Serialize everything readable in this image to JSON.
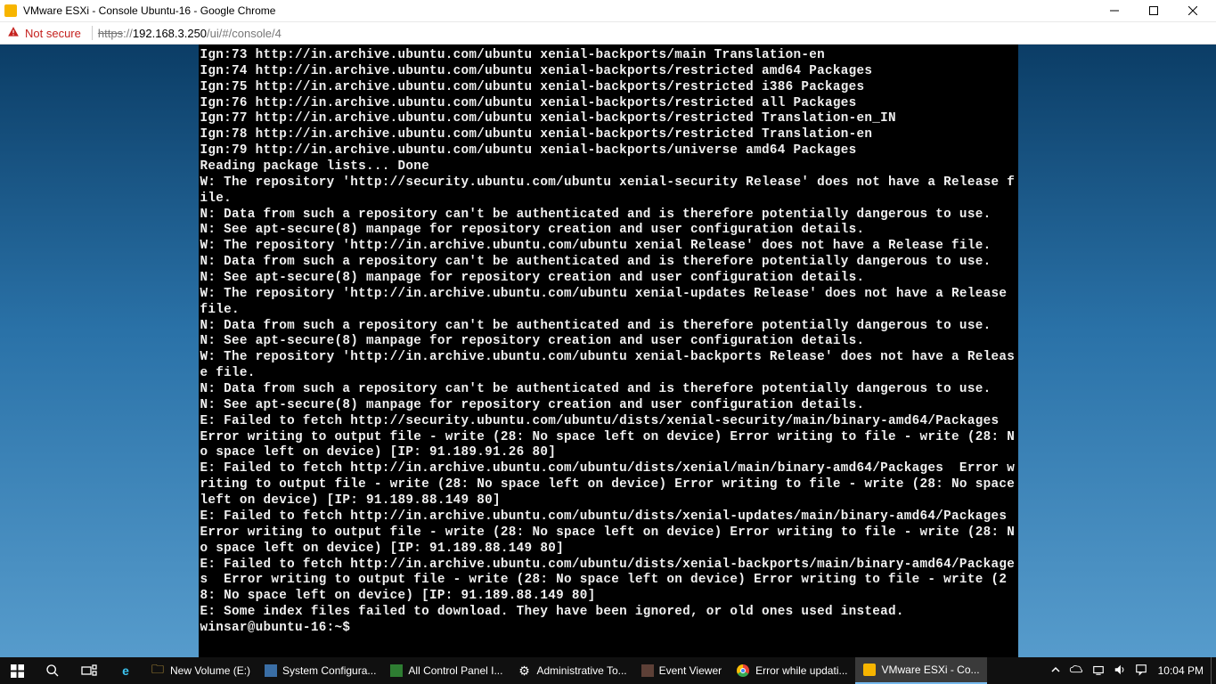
{
  "window": {
    "title": "VMware ESXi - Console Ubuntu-16 - Google Chrome"
  },
  "addressbar": {
    "not_secure": "Not secure",
    "url_scheme": "https",
    "url_sep": "://",
    "url_host": "192.168.3.250",
    "url_path": "/ui/#/console/4"
  },
  "console_text": "Ign:73 http://in.archive.ubuntu.com/ubuntu xenial-backports/main Translation-en\nIgn:74 http://in.archive.ubuntu.com/ubuntu xenial-backports/restricted amd64 Packages\nIgn:75 http://in.archive.ubuntu.com/ubuntu xenial-backports/restricted i386 Packages\nIgn:76 http://in.archive.ubuntu.com/ubuntu xenial-backports/restricted all Packages\nIgn:77 http://in.archive.ubuntu.com/ubuntu xenial-backports/restricted Translation-en_IN\nIgn:78 http://in.archive.ubuntu.com/ubuntu xenial-backports/restricted Translation-en\nIgn:79 http://in.archive.ubuntu.com/ubuntu xenial-backports/universe amd64 Packages\nReading package lists... Done\nW: The repository 'http://security.ubuntu.com/ubuntu xenial-security Release' does not have a Release file.\nN: Data from such a repository can't be authenticated and is therefore potentially dangerous to use.\nN: See apt-secure(8) manpage for repository creation and user configuration details.\nW: The repository 'http://in.archive.ubuntu.com/ubuntu xenial Release' does not have a Release file.\nN: Data from such a repository can't be authenticated and is therefore potentially dangerous to use.\nN: See apt-secure(8) manpage for repository creation and user configuration details.\nW: The repository 'http://in.archive.ubuntu.com/ubuntu xenial-updates Release' does not have a Release file.\nN: Data from such a repository can't be authenticated and is therefore potentially dangerous to use.\nN: See apt-secure(8) manpage for repository creation and user configuration details.\nW: The repository 'http://in.archive.ubuntu.com/ubuntu xenial-backports Release' does not have a Release file.\nN: Data from such a repository can't be authenticated and is therefore potentially dangerous to use.\nN: See apt-secure(8) manpage for repository creation and user configuration details.\nE: Failed to fetch http://security.ubuntu.com/ubuntu/dists/xenial-security/main/binary-amd64/Packages  Error writing to output file - write (28: No space left on device) Error writing to file - write (28: No space left on device) [IP: 91.189.91.26 80]\nE: Failed to fetch http://in.archive.ubuntu.com/ubuntu/dists/xenial/main/binary-amd64/Packages  Error writing to output file - write (28: No space left on device) Error writing to file - write (28: No space left on device) [IP: 91.189.88.149 80]\nE: Failed to fetch http://in.archive.ubuntu.com/ubuntu/dists/xenial-updates/main/binary-amd64/Packages  Error writing to output file - write (28: No space left on device) Error writing to file - write (28: No space left on device) [IP: 91.189.88.149 80]\nE: Failed to fetch http://in.archive.ubuntu.com/ubuntu/dists/xenial-backports/main/binary-amd64/Packages  Error writing to output file - write (28: No space left on device) Error writing to file - write (28: No space left on device) [IP: 91.189.88.149 80]\nE: Some index files failed to download. They have been ignored, or old ones used instead.\nwinsar@ubuntu-16:~$ ",
  "taskbar": {
    "items": [
      {
        "label": "New Volume (E:)"
      },
      {
        "label": "System Configura..."
      },
      {
        "label": "All Control Panel I..."
      },
      {
        "label": "Administrative To..."
      },
      {
        "label": "Event Viewer"
      },
      {
        "label": "Error while updati..."
      },
      {
        "label": "VMware ESXi - Co..."
      }
    ],
    "clock": "10:04 PM"
  }
}
